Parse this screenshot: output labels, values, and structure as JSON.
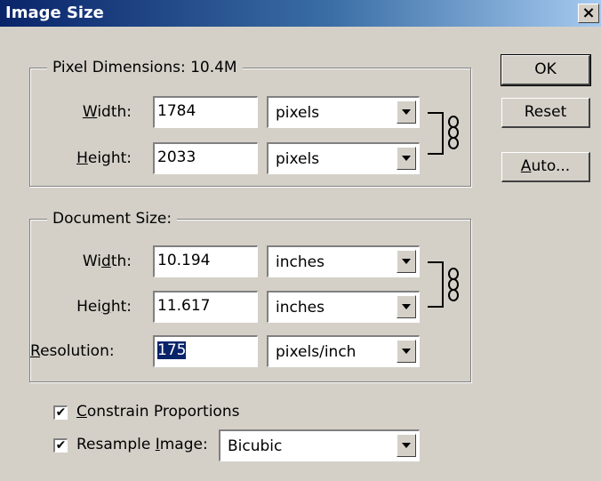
{
  "window": {
    "title": "Image Size",
    "close_icon": "close-icon"
  },
  "pixel_dimensions": {
    "legend": "Pixel Dimensions:",
    "size": "10.4M",
    "width_label_pre": "",
    "width_label_u": "W",
    "width_label_post": "idth:",
    "width_value": "1784",
    "width_unit": "pixels",
    "height_label_u": "H",
    "height_label_post": "eight:",
    "height_value": "2033",
    "height_unit": "pixels"
  },
  "document_size": {
    "legend": "Document Size:",
    "width_label_pre": "Wi",
    "width_label_u": "d",
    "width_label_post": "th:",
    "width_value": "10.194",
    "width_unit": "inches",
    "height_label_pre": "Hei",
    "height_label_u": "g",
    "height_label_post": "ht:",
    "height_value": "11.617",
    "height_unit": "inches",
    "resolution_label_u": "R",
    "resolution_label_post": "esolution:",
    "resolution_value": "175",
    "resolution_unit": "pixels/inch"
  },
  "options": {
    "constrain_u": "C",
    "constrain_post": "onstrain Proportions",
    "constrain_checked": true,
    "resample_pre": "Resample ",
    "resample_u": "I",
    "resample_post": "mage:",
    "resample_checked": true,
    "resample_method": "Bicubic"
  },
  "buttons": {
    "ok": "OK",
    "reset": "Reset",
    "auto_u": "A",
    "auto_post": "uto..."
  },
  "check_mark": "✔"
}
